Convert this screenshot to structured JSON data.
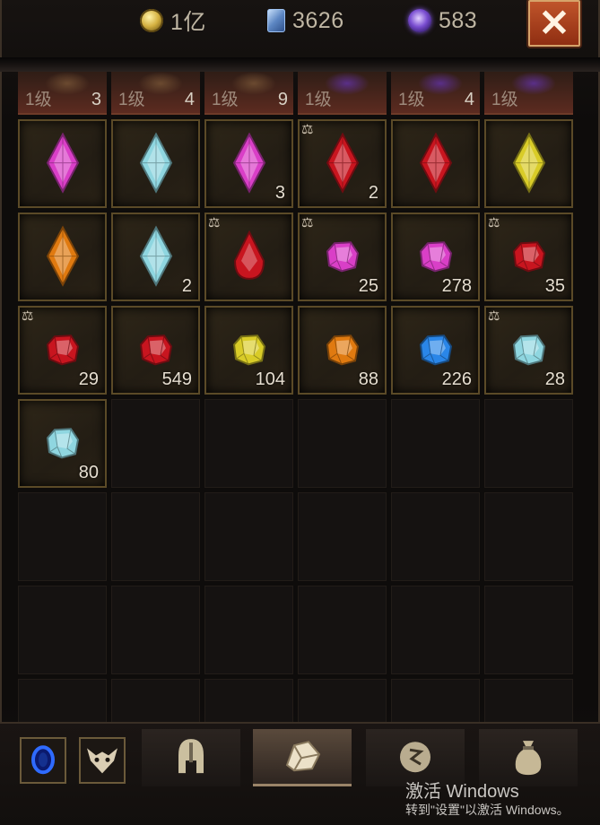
{
  "currencies": {
    "gold": {
      "value": "1亿",
      "icon": "gold-coin-icon"
    },
    "cards": {
      "value": "3626",
      "icon": "card-icon"
    },
    "orbs": {
      "value": "583",
      "icon": "purple-orb-icon"
    }
  },
  "close_icon": "close-icon",
  "top_row": [
    {
      "level": "1级",
      "count": "3"
    },
    {
      "level": "1级",
      "count": "4"
    },
    {
      "level": "1级",
      "count": "9"
    },
    {
      "level": "1级",
      "count": ""
    },
    {
      "level": "1级",
      "count": "4"
    },
    {
      "level": "1级",
      "count": ""
    }
  ],
  "inventory": [
    {
      "gem": "marquise-magenta",
      "count": "",
      "scale": false
    },
    {
      "gem": "marquise-cyan",
      "count": "",
      "scale": false
    },
    {
      "gem": "marquise-magenta",
      "count": "3",
      "scale": false
    },
    {
      "gem": "marquise-red",
      "count": "2",
      "scale": true
    },
    {
      "gem": "marquise-red",
      "count": "",
      "scale": false
    },
    {
      "gem": "marquise-yellow",
      "count": "",
      "scale": false
    },
    {
      "gem": "marquise-orange",
      "count": "",
      "scale": false
    },
    {
      "gem": "marquise-cyan",
      "count": "2",
      "scale": false
    },
    {
      "gem": "teardrop-red",
      "count": "",
      "scale": true
    },
    {
      "gem": "rough-magenta",
      "count": "25",
      "scale": true
    },
    {
      "gem": "rough-magenta",
      "count": "278",
      "scale": false
    },
    {
      "gem": "rough-red",
      "count": "35",
      "scale": true
    },
    {
      "gem": "rough-red",
      "count": "29",
      "scale": true
    },
    {
      "gem": "rough-red",
      "count": "549",
      "scale": false
    },
    {
      "gem": "rough-yellow",
      "count": "104",
      "scale": false
    },
    {
      "gem": "rough-orange",
      "count": "88",
      "scale": false
    },
    {
      "gem": "rough-blue",
      "count": "226",
      "scale": false
    },
    {
      "gem": "rough-cyan",
      "count": "28",
      "scale": true
    },
    {
      "gem": "rough-cyan",
      "count": "80",
      "scale": false
    }
  ],
  "scale_glyph": "⚖",
  "colors": {
    "magenta": "#d93fc7",
    "cyan": "#8fd6e0",
    "red": "#c8151f",
    "yellow": "#d9cc28",
    "orange": "#e07a10",
    "blue": "#2a86e8"
  },
  "tabs": [
    {
      "icon": "blue-portal-icon",
      "active": false
    },
    {
      "icon": "demon-mask-icon",
      "active": false
    },
    {
      "icon": "helmet-icon",
      "active": false
    },
    {
      "icon": "gem-pouch-icon",
      "active": true
    },
    {
      "icon": "rune-stone-icon",
      "active": false
    },
    {
      "icon": "loot-bag-icon",
      "active": false
    }
  ],
  "watermark": {
    "line1": "激活 Windows",
    "line2": "转到\"设置\"以激活 Windows。"
  }
}
